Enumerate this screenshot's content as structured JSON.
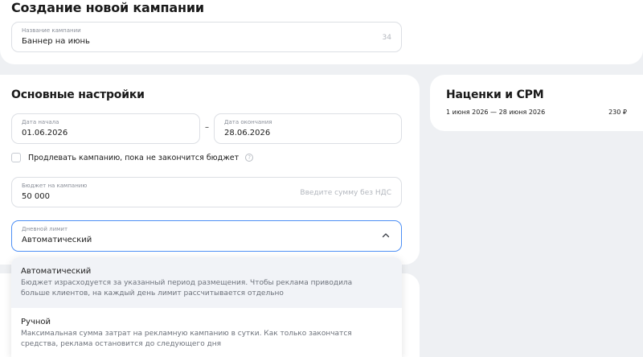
{
  "page": {
    "title": "Создание новой кампании"
  },
  "campaign_name": {
    "label": "Название кампании",
    "value": "Баннер на июнь",
    "counter": "34"
  },
  "main_settings": {
    "title": "Основные настройки",
    "start_date": {
      "label": "Дата начала",
      "value": "01.06.2026"
    },
    "dash": "–",
    "end_date": {
      "label": "Дата окончания",
      "value": "28.06.2026"
    },
    "extend_checkbox": {
      "label": "Продлевать кампанию, пока не закончится бюджет",
      "checked": false,
      "help": "?"
    },
    "budget": {
      "label": "Бюджет на кампанию",
      "value": "50 000",
      "placeholder": "Введите сумму без НДС"
    },
    "daily_limit": {
      "label": "Дневной лимит",
      "value": "Автоматический",
      "expanded": true
    }
  },
  "dropdown": {
    "options": [
      {
        "title": "Автоматический",
        "description": "Бюджет израсходуется за указанный период размещения. Чтобы реклама приводила больше клиентов, на каждый день лимит рассчитывается отдельно",
        "highlighted": true
      },
      {
        "title": "Ручной",
        "description": "Максимальная сумма затрат на рекламную кампанию в сутки. Как только закончатся средства, реклама остановится до следующего дня",
        "highlighted": false
      }
    ]
  },
  "side_panel": {
    "title": "Наценки и CPM",
    "period": "1 июня 2026 — 28 июня 2026",
    "price": "230 ₽"
  },
  "colors": {
    "background": "#eef0f3",
    "focus_border": "#4d8ff5",
    "highlight": "#f1f3f7"
  },
  "icons": {
    "help": "question-circle-icon",
    "chevron": "chevron-up-icon"
  }
}
